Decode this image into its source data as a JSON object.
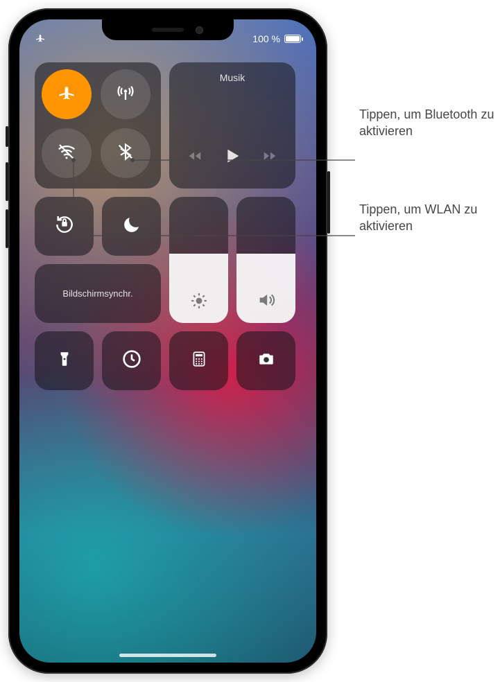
{
  "status": {
    "battery_pct": "100 %",
    "airplane_on": true
  },
  "connectivity": {
    "airplane": {
      "label": "airplane-mode",
      "active": true
    },
    "cellular": {
      "label": "cellular-data",
      "active": false
    },
    "wifi": {
      "label": "wifi",
      "active": false
    },
    "bluetooth": {
      "label": "bluetooth",
      "active": false
    }
  },
  "music": {
    "title": "Musik"
  },
  "controls": {
    "orientation_lock": "orientation-lock",
    "dnd": "do-not-disturb",
    "screen_mirroring_label": "Bildschirmsynchr.",
    "flashlight": "flashlight",
    "timer": "timer",
    "calculator": "calculator",
    "camera": "camera"
  },
  "sliders": {
    "brightness_pct": 55,
    "volume_pct": 55
  },
  "callouts": {
    "bluetooth": "Tippen, um Bluetooth zu aktivieren",
    "wlan": "Tippen, um WLAN zu aktivieren"
  },
  "colors": {
    "airplane_on_bg": "#ff9500",
    "tile_bg": "rgba(20,20,25,0.55)"
  }
}
